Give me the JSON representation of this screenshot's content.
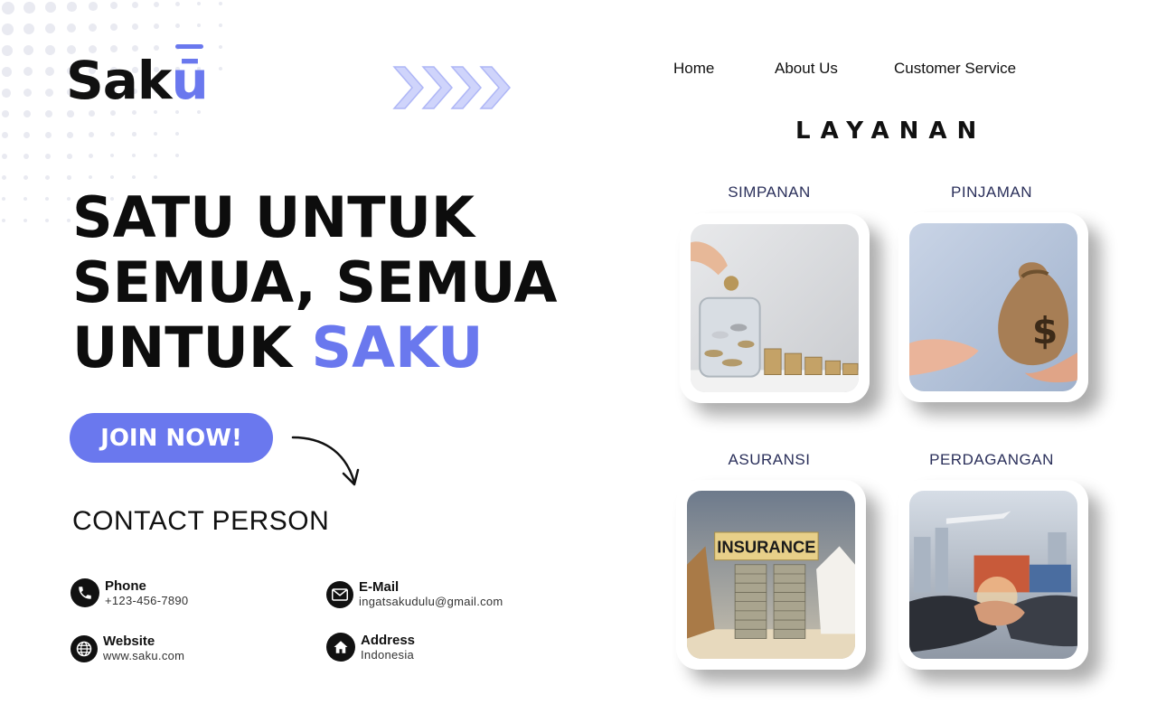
{
  "brand": {
    "logo_main": "Sak",
    "logo_accent": "ū",
    "accent_color": "#6a78ee"
  },
  "nav": {
    "home": "Home",
    "about": "About Us",
    "service": "Customer Service"
  },
  "hero": {
    "line1": "SATU UNTUK",
    "line2": "SEMUA, SEMUA",
    "line3_plain": "UNTUK",
    "line3_accent": "SAKU"
  },
  "cta": {
    "join_label": "JOIN NOW!"
  },
  "contact": {
    "title": "CONTACT PERSON",
    "phone_label": "Phone",
    "phone_value": "+123-456-7890",
    "email_label": "E-Mail",
    "email_value": "ingatsakudulu@gmail.com",
    "website_label": "Website",
    "website_value": "www.saku.com",
    "address_label": "Address",
    "address_value": "Indonesia"
  },
  "services": {
    "title": "LAYANAN",
    "items": [
      {
        "label": "SIMPANAN",
        "icon": "savings-coins-image"
      },
      {
        "label": "PINJAMAN",
        "icon": "loan-money-bag-image"
      },
      {
        "label": "ASURANSI",
        "icon": "insurance-coins-image"
      },
      {
        "label": "PERDAGANGAN",
        "icon": "trade-handshake-image"
      }
    ]
  }
}
